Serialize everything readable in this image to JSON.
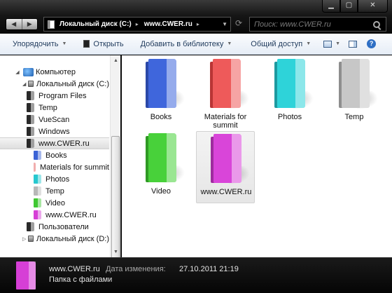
{
  "window": {
    "controls": {
      "minimize": "▁",
      "maximize": "▢",
      "close": "✕"
    }
  },
  "navigation": {
    "back_icon": "◀",
    "forward_icon": "▶"
  },
  "address_bar": {
    "breadcrumbs": [
      "Локальный диск (C:)",
      "www.CWER.ru"
    ],
    "separator": "▸",
    "dropdown_icon": "▼"
  },
  "refresh_icon": "⟳",
  "search": {
    "placeholder": "Поиск: www.CWER.ru"
  },
  "toolbar": {
    "organize": "Упорядочить",
    "open": "Открыть",
    "add_to_library": "Добавить в библиотеку",
    "share": "Общий доступ",
    "help": "?",
    "arrow": "▼"
  },
  "nav_tree": [
    {
      "label": "Компьютер",
      "kind": "computer"
    },
    {
      "label": "Локальный диск (C:)",
      "kind": "drive"
    },
    {
      "label": "Program Files",
      "kind": "folder-dark"
    },
    {
      "label": "Temp",
      "kind": "folder-dark"
    },
    {
      "label": "VueScan",
      "kind": "folder-dark"
    },
    {
      "label": "Windows",
      "kind": "folder-dark"
    },
    {
      "label": "www.CWER.ru",
      "kind": "folder-dark",
      "selected": true
    },
    {
      "label": "Books",
      "color": "#3b63d6"
    },
    {
      "label": "Materials for summit",
      "color": "#e04a4a"
    },
    {
      "label": "Photos",
      "color": "#27c8cf"
    },
    {
      "label": "Temp",
      "color": "#b8b8b8"
    },
    {
      "label": "Video",
      "color": "#3fc832"
    },
    {
      "label": "www.CWER.ru",
      "color": "#d63fd6"
    },
    {
      "label": "Пользователи",
      "kind": "folder-dark"
    },
    {
      "label": "Локальный диск (D:)",
      "kind": "drive"
    }
  ],
  "folders": [
    {
      "label": "Books",
      "color": "#3f66dc",
      "dark": "#2b48a8"
    },
    {
      "label": "Materials for summit",
      "color": "#ee5a5a",
      "dark": "#b93535"
    },
    {
      "label": "Photos",
      "color": "#2ed3d9",
      "dark": "#1d9aa0"
    },
    {
      "label": "Temp",
      "color": "#c7c7c7",
      "dark": "#8e8e8e"
    },
    {
      "label": "Video",
      "color": "#48d13a",
      "dark": "#2f9a24"
    },
    {
      "label": "www.CWER.ru",
      "color": "#d945d9",
      "dark": "#9e2c9e",
      "selected": true
    }
  ],
  "details": {
    "name": "www.CWER.ru",
    "type": "Папка с файлами",
    "date_label": "Дата изменения:",
    "date_value": "27.10.2011 21:19",
    "icon_color": "#d63fd6"
  },
  "colors": {
    "folder_dark_icon": "#2a2a2a",
    "accent_toolbar_text": "#1e395b"
  }
}
